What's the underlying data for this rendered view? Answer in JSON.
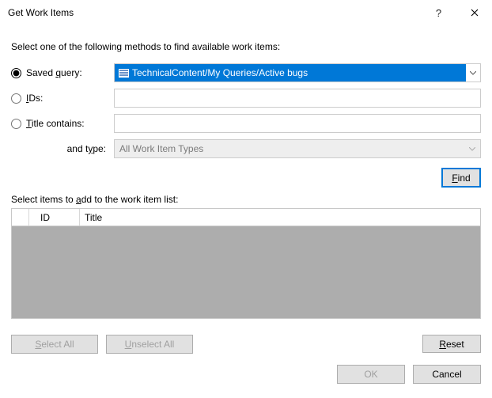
{
  "title": "Get Work Items",
  "instruction": "Select one of the following methods to find available work items:",
  "methods": {
    "saved_query": {
      "label_pre": "Saved ",
      "label_u": "q",
      "label_post": "uery:"
    },
    "ids": {
      "label_pre": "",
      "label_u": "I",
      "label_post": "Ds:"
    },
    "title": {
      "label_pre": "",
      "label_u": "T",
      "label_post": "itle contains:"
    },
    "type": {
      "label_pre": "and t",
      "label_u": "y",
      "label_post": "pe:"
    }
  },
  "saved_query_value": "TechnicalContent/My Queries/Active bugs",
  "ids_value": "",
  "title_value": "",
  "type_value": "All Work Item Types",
  "find_btn": {
    "pre": "",
    "u": "F",
    "post": "ind"
  },
  "list_label": {
    "pre": "Select items to ",
    "u": "a",
    "post": "dd to the work item list:"
  },
  "columns": {
    "id": "ID",
    "title": "Title"
  },
  "buttons": {
    "select_all": {
      "pre": "",
      "u": "S",
      "post": "elect All"
    },
    "unselect_all": {
      "pre": "",
      "u": "U",
      "post": "nselect All"
    },
    "reset": {
      "pre": "",
      "u": "R",
      "post": "eset"
    },
    "ok": "OK",
    "cancel": "Cancel"
  }
}
